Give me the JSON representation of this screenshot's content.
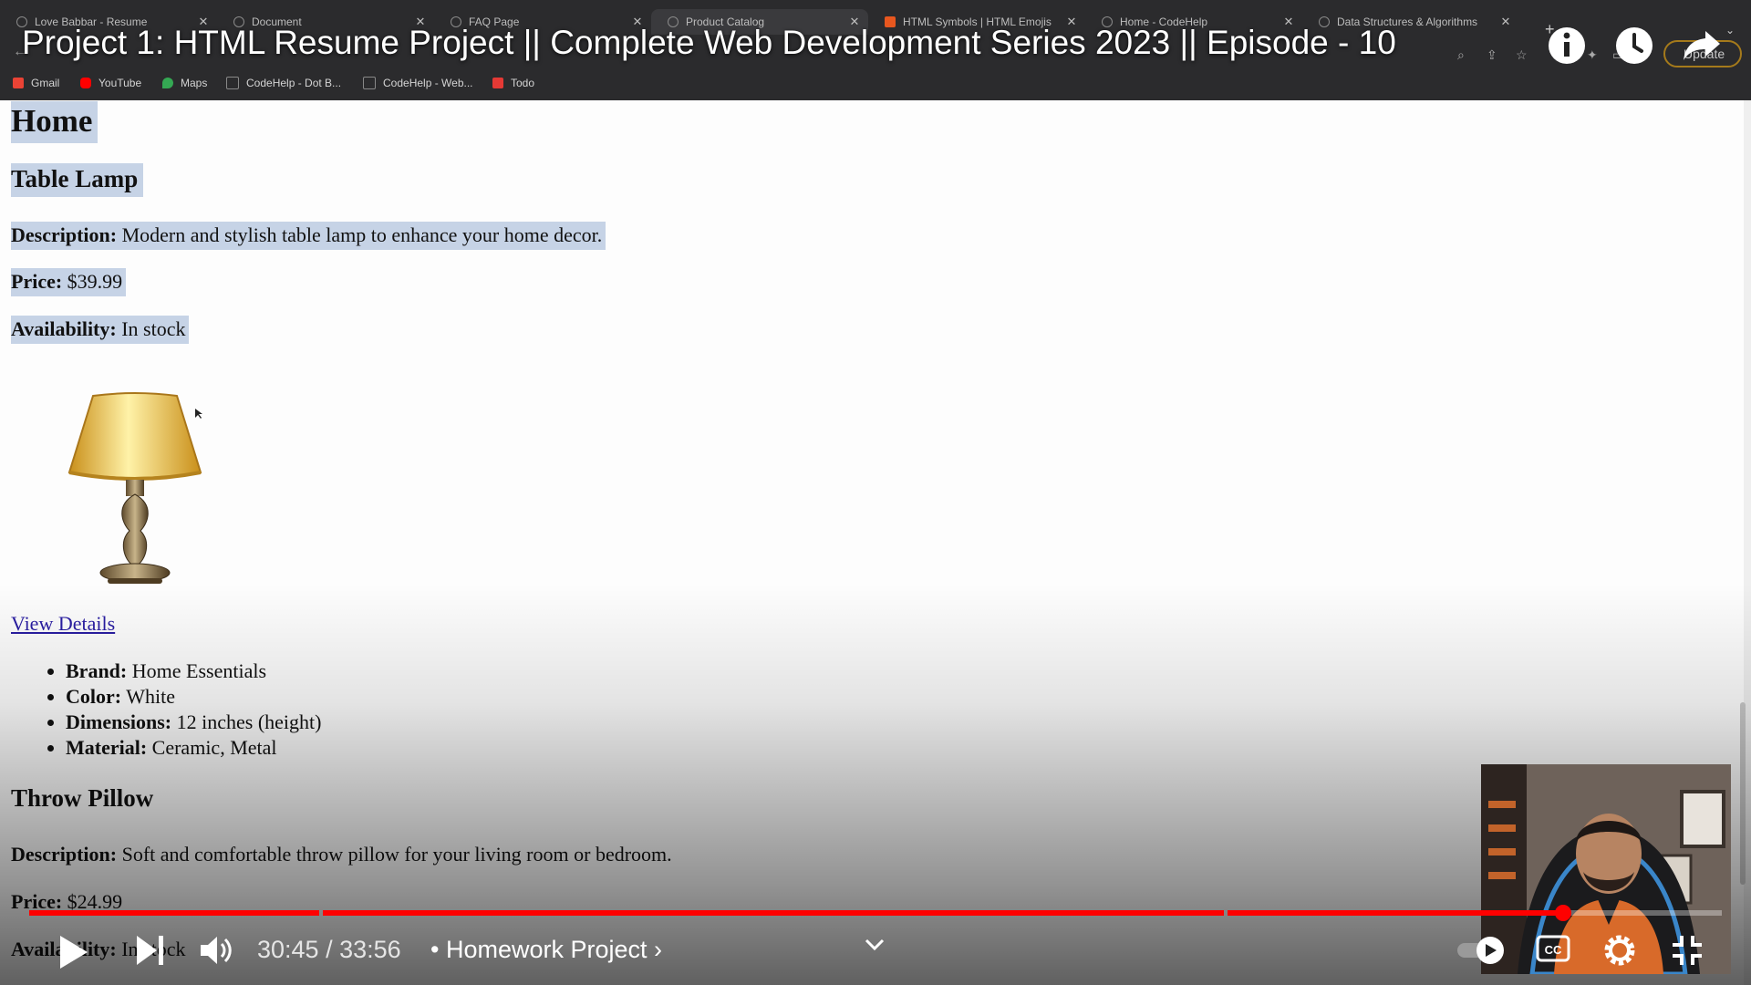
{
  "browser": {
    "tabs": [
      {
        "title": "Love Babbar - Resume",
        "active": false
      },
      {
        "title": "Document",
        "active": false
      },
      {
        "title": "FAQ Page",
        "active": false
      },
      {
        "title": "Product Catalog",
        "active": true
      },
      {
        "title": "HTML Symbols | HTML Emojis",
        "active": false
      },
      {
        "title": "Home - CodeHelp",
        "active": false
      },
      {
        "title": "Data Structures & Algorithms",
        "active": false
      }
    ],
    "new_tab": "+",
    "update_button": "Update",
    "bookmarks": [
      {
        "label": "Gmail",
        "color": "#ea4335"
      },
      {
        "label": "YouTube",
        "color": "#ff0000"
      },
      {
        "label": "Maps",
        "color": "#34a853"
      },
      {
        "label": "CodeHelp - Dot B...",
        "color": "#5a5a5a"
      },
      {
        "label": "CodeHelp - Web...",
        "color": "#5a5a5a"
      },
      {
        "label": "Todo",
        "color": "#e53935"
      }
    ]
  },
  "video": {
    "title": "Project 1: HTML Resume Project || Complete Web Development Series 2023 || Episode - 10",
    "current_time": "30:45",
    "duration": "33:56",
    "time_display": "30:45 / 33:56",
    "chapter": "• Homework Project",
    "chapter_arrow": "›",
    "progress_fraction": 0.906,
    "accent_color": "#ff0000"
  },
  "page": {
    "heading": "Home",
    "products": [
      {
        "name": "Table Lamp",
        "description_label": "Description:",
        "description": "Modern and stylish table lamp to enhance your home decor.",
        "price_label": "Price:",
        "price": "$39.99",
        "availability_label": "Availability:",
        "availability": "In stock",
        "link": "View Details",
        "specs": [
          {
            "label": "Brand:",
            "value": "Home Essentials"
          },
          {
            "label": "Color:",
            "value": "White"
          },
          {
            "label": "Dimensions:",
            "value": "12 inches (height)"
          },
          {
            "label": "Material:",
            "value": "Ceramic, Metal"
          }
        ]
      },
      {
        "name": "Throw Pillow",
        "description_label": "Description:",
        "description": "Soft and comfortable throw pillow for your living room or bedroom.",
        "price_label": "Price:",
        "price": "$24.99",
        "availability_label": "Availability:",
        "availability": "In stock"
      }
    ]
  },
  "selection_color": "#c6d3e6",
  "link_color": "#2a1ea3"
}
